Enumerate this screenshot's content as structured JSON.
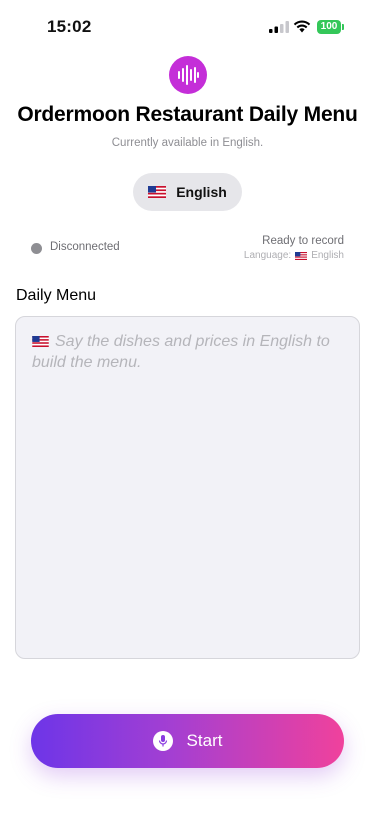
{
  "status_bar": {
    "time": "15:02",
    "battery_level": "100",
    "icons": [
      "signal-icon",
      "wifi-icon",
      "battery-icon"
    ]
  },
  "header": {
    "app_icon": "audio-waveform-icon",
    "title": "Ordermoon Restaurant Daily Menu",
    "subtitle": "Currently available in English."
  },
  "language_selector": {
    "flag_icon": "us-flag-icon",
    "label": "English"
  },
  "connection": {
    "status": "Disconnected",
    "indicator_color": "#8e8e93",
    "ready_text": "Ready to record",
    "language_prefix": "Language:",
    "language_flag_icon": "us-flag-icon",
    "language": "English"
  },
  "menu_section": {
    "title": "Daily Menu",
    "value": "",
    "placeholder": "Say the dishes and prices in English to build the menu."
  },
  "start_button": {
    "icon": "microphone-icon",
    "label": "Start",
    "gradient": [
      "#6d35e8",
      "#a43fd2",
      "#f0419c"
    ]
  },
  "colors": {
    "accent": "#c42ed8",
    "battery": "#34c759"
  }
}
